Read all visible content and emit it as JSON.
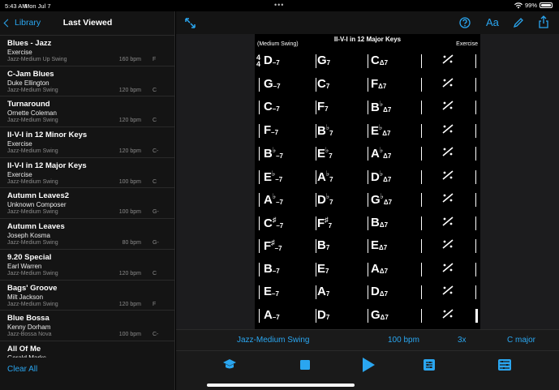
{
  "status": {
    "time": "5:43 AM",
    "date": "Mon Jul 7",
    "battery": "99%",
    "battery_level": 0.99
  },
  "sidebar": {
    "back_label": "Library",
    "title": "Last Viewed",
    "clear_label": "Clear All",
    "items": [
      {
        "title": "Blues - Jazz",
        "composer": "Exercise",
        "style": "Jazz-Medium Up Swing",
        "bpm": "160 bpm",
        "key": "F"
      },
      {
        "title": "C-Jam Blues",
        "composer": "Duke Ellington",
        "style": "Jazz-Medium Swing",
        "bpm": "120 bpm",
        "key": "C"
      },
      {
        "title": "Turnaround",
        "composer": "Ornette Coleman",
        "style": "Jazz-Medium Swing",
        "bpm": "120 bpm",
        "key": "C"
      },
      {
        "title": "II-V-I in 12 Minor Keys",
        "composer": "Exercise",
        "style": "Jazz-Medium Swing",
        "bpm": "120 bpm",
        "key": "C-"
      },
      {
        "title": "II-V-I in 12 Major Keys",
        "composer": "Exercise",
        "style": "Jazz-Medium Swing",
        "bpm": "100 bpm",
        "key": "C"
      },
      {
        "title": "Autumn Leaves2",
        "composer": "Unknown Composer",
        "style": "Jazz-Medium Swing",
        "bpm": "100 bpm",
        "key": "G-"
      },
      {
        "title": "Autumn Leaves",
        "composer": "Joseph Kosma",
        "style": "Jazz-Medium Swing",
        "bpm": "80 bpm",
        "key": "G-"
      },
      {
        "title": "9.20 Special",
        "composer": "Earl Warren",
        "style": "Jazz-Medium Swing",
        "bpm": "120 bpm",
        "key": "C"
      },
      {
        "title": "Bags' Groove",
        "composer": "Milt Jackson",
        "style": "Jazz-Medium Swing",
        "bpm": "120 bpm",
        "key": "F"
      },
      {
        "title": "Blue Bossa",
        "composer": "Kenny Dorham",
        "style": "Jazz-Bossa Nova",
        "bpm": "100 bpm",
        "key": "C-"
      },
      {
        "title": "All Of Me",
        "composer": "Gerald Marks",
        "style": "",
        "bpm": "",
        "key": ""
      }
    ]
  },
  "toolbar": {
    "font_label": "Aa"
  },
  "sheet": {
    "title": "II-V-I in 12 Major Keys",
    "style": "(Medium Swing)",
    "composer": "Exercise",
    "time_top": "4",
    "time_bottom": "4",
    "rows": [
      [
        "D–7",
        "G7",
        "CΔ7"
      ],
      [
        "G–7",
        "C7",
        "FΔ7"
      ],
      [
        "C–7",
        "F7",
        "B♭Δ7"
      ],
      [
        "F–7",
        "B♭7",
        "E♭Δ7"
      ],
      [
        "B♭–7",
        "E♭7",
        "A♭Δ7"
      ],
      [
        "E♭–7",
        "A♭7",
        "D♭Δ7"
      ],
      [
        "A♭–7",
        "D♭7",
        "G♭Δ7"
      ],
      [
        "C♯–7",
        "F♯7",
        "BΔ7"
      ],
      [
        "F♯–7",
        "B7",
        "EΔ7"
      ],
      [
        "B–7",
        "E7",
        "AΔ7"
      ],
      [
        "E–7",
        "A7",
        "DΔ7"
      ],
      [
        "A–7",
        "D7",
        "GΔ7"
      ]
    ]
  },
  "info": {
    "style": "Jazz-Medium Swing",
    "tempo": "100 bpm",
    "repeats": "3x",
    "key": "C major"
  },
  "colors": {
    "accent": "#2aa6f0",
    "background": "#000000",
    "panel": "#141414"
  },
  "icons": {
    "expand": "expand-arrows-icon",
    "help": "question-circle-icon",
    "font": "font-size-icon",
    "edit": "pencil-icon",
    "share": "share-icon",
    "practice": "graduation-cap-icon",
    "stop": "stop-icon",
    "play": "play-icon",
    "mixer": "mixer-icon",
    "settings": "sliders-icon"
  }
}
